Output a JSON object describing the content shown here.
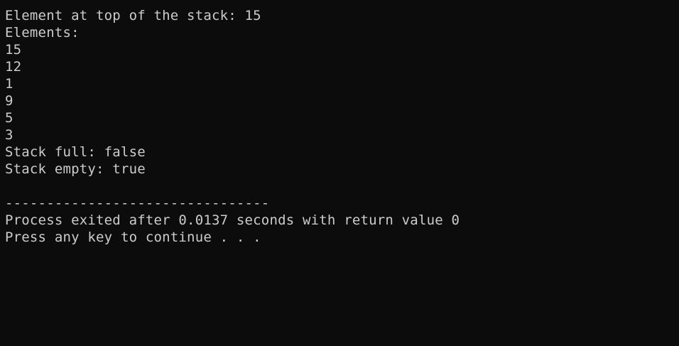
{
  "console": {
    "lines": [
      "Element at top of the stack: 15",
      "Elements:",
      "15",
      "12",
      "1",
      "9",
      "5",
      "3",
      "Stack full: false",
      "Stack empty: true",
      "",
      "--------------------------------",
      "Process exited after 0.0137 seconds with return value 0",
      "Press any key to continue . . ."
    ]
  },
  "colors": {
    "background": "#0c0c0c",
    "text": "#cccccc"
  }
}
